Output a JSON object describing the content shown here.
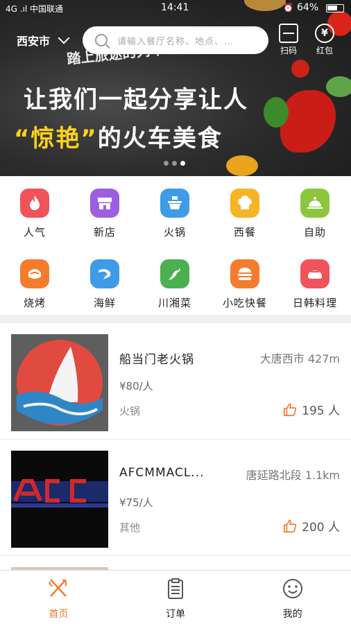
{
  "status_bar": {
    "carrier": "4G .ıl 中国联通",
    "time": "14:41",
    "battery": "64%"
  },
  "header": {
    "city": "西安市",
    "search_placeholder": "请输入餐厅名称、地点、…",
    "scan_label": "扫码",
    "hongbao_label": "红包"
  },
  "banner": {
    "tagline": "踏上旅途的列车",
    "title_line1": "让我们一起分享让人",
    "title_highlight": "“惊艳”",
    "title_line2_rest": "的火车美食",
    "page_count": 3,
    "active_page": 2
  },
  "categories": [
    {
      "label": "人气",
      "icon": "fire-icon",
      "color": "#f0535a"
    },
    {
      "label": "新店",
      "icon": "store-icon",
      "color": "#9b5fe0"
    },
    {
      "label": "火锅",
      "icon": "hotpot-icon",
      "color": "#3e9be8"
    },
    {
      "label": "西餐",
      "icon": "chef-hat-icon",
      "color": "#f6b324"
    },
    {
      "label": "自助",
      "icon": "dish-cover-icon",
      "color": "#8cc63f"
    },
    {
      "label": "烧烤",
      "icon": "grill-icon",
      "color": "#f47c2c"
    },
    {
      "label": "海鲜",
      "icon": "shrimp-icon",
      "color": "#3e9be8"
    },
    {
      "label": "川湘菜",
      "icon": "chili-icon",
      "color": "#4cb050"
    },
    {
      "label": "小吃快餐",
      "icon": "burger-icon",
      "color": "#f47c2c"
    },
    {
      "label": "日韩料理",
      "icon": "sushi-icon",
      "color": "#f0535a"
    }
  ],
  "restaurants": [
    {
      "name": "船当门老火锅",
      "area": "大唐西市  427m",
      "price": "¥80/人",
      "type": "火锅",
      "likes": "195 人"
    },
    {
      "name": "AFCMMACL...",
      "area": "唐延路北段  1.1km",
      "price": "¥75/人",
      "type": "其他",
      "likes": "200 人"
    }
  ],
  "bottom_nav": [
    {
      "label": "首页",
      "icon": "fork-knife-icon",
      "active": true
    },
    {
      "label": "订单",
      "icon": "clipboard-icon",
      "active": false
    },
    {
      "label": "我的",
      "icon": "smiley-icon",
      "active": false
    }
  ],
  "colors": {
    "accent": "#f07a2c",
    "highlight": "#ffd21a"
  }
}
